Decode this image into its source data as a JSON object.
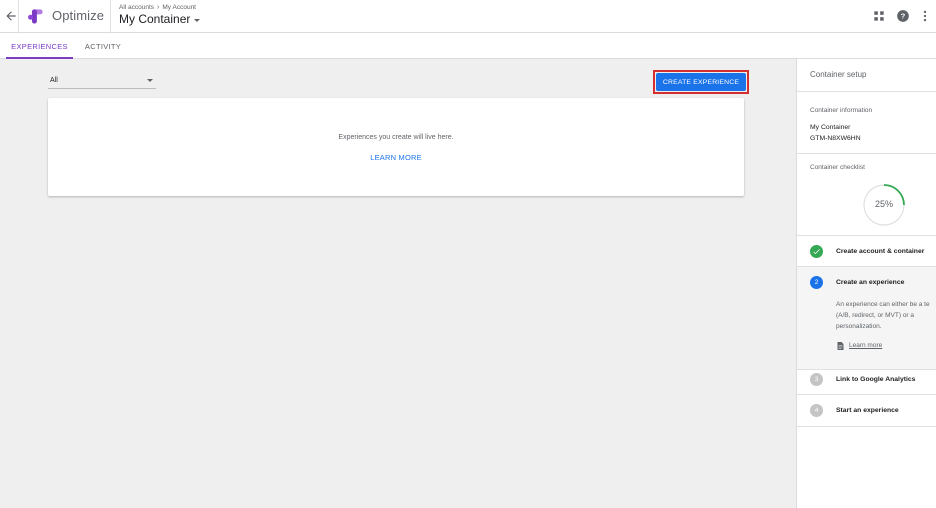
{
  "header": {
    "app_name": "Optimize",
    "breadcrumb": [
      "All accounts",
      "My Account"
    ],
    "container_name": "My Container"
  },
  "tabs": [
    {
      "label": "EXPERIENCES",
      "active": true
    },
    {
      "label": "ACTIVITY",
      "active": false
    }
  ],
  "filter": {
    "value": "All"
  },
  "create_button": {
    "label": "CREATE EXPERIENCE"
  },
  "empty_state": {
    "message": "Experiences you create will live here.",
    "learn_more": "LEARN MORE"
  },
  "panel": {
    "title": "Container setup",
    "info_label": "Container information",
    "container_name": "My Container",
    "container_id": "GTM-N8XW6HN",
    "checklist_label": "Container checklist",
    "progress_text": "25%",
    "progress_value": 0.25,
    "steps": [
      {
        "label": "Create account & container",
        "status": "done"
      },
      {
        "number": "2",
        "label": "Create an experience",
        "status": "active",
        "description": [
          "An experience can either be a te",
          "(A/B, redirect, or MVT) or a",
          "personalization."
        ],
        "link": "Learn more"
      },
      {
        "number": "3",
        "label": "Link to Google Analytics",
        "status": "pending"
      },
      {
        "number": "4",
        "label": "Start an experience",
        "status": "pending"
      }
    ]
  },
  "colors": {
    "accent": "#7b3cc4",
    "primary": "#1a73e8",
    "success": "#34a853",
    "highlight": "#d32f2f"
  },
  "icons": [
    "back-arrow-icon",
    "optimize-logo-icon",
    "apps-grid-icon",
    "help-icon",
    "more-vert-icon",
    "check-icon",
    "document-icon"
  ]
}
